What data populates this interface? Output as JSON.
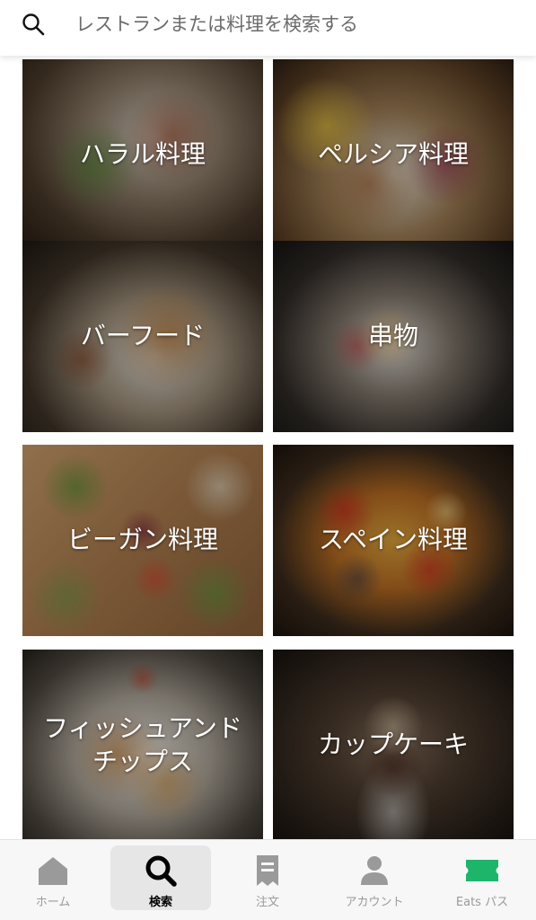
{
  "search": {
    "placeholder": "レストランまたは料理を検索する",
    "value": ""
  },
  "categories": [
    {
      "label": "ハラル料理"
    },
    {
      "label": "ペルシア料理"
    },
    {
      "label": "バーフード"
    },
    {
      "label": "串物"
    },
    {
      "label": "ビーガン料理"
    },
    {
      "label": "スペイン料理"
    },
    {
      "label": "フィッシュアンドチップス"
    },
    {
      "label": "カップケーキ"
    }
  ],
  "nav": {
    "items": [
      {
        "label": "ホーム",
        "icon": "home-icon",
        "active": false
      },
      {
        "label": "検索",
        "icon": "search-icon",
        "active": true
      },
      {
        "label": "注文",
        "icon": "receipt-icon",
        "active": false
      },
      {
        "label": "アカウント",
        "icon": "person-icon",
        "active": false
      },
      {
        "label": "Eats パス",
        "icon": "ticket-icon",
        "active": false
      }
    ]
  },
  "colors": {
    "eats_pass_green": "#1db56a",
    "active_tab_bg": "#e6e6e6",
    "inactive_tab": "#9a9a9a"
  }
}
